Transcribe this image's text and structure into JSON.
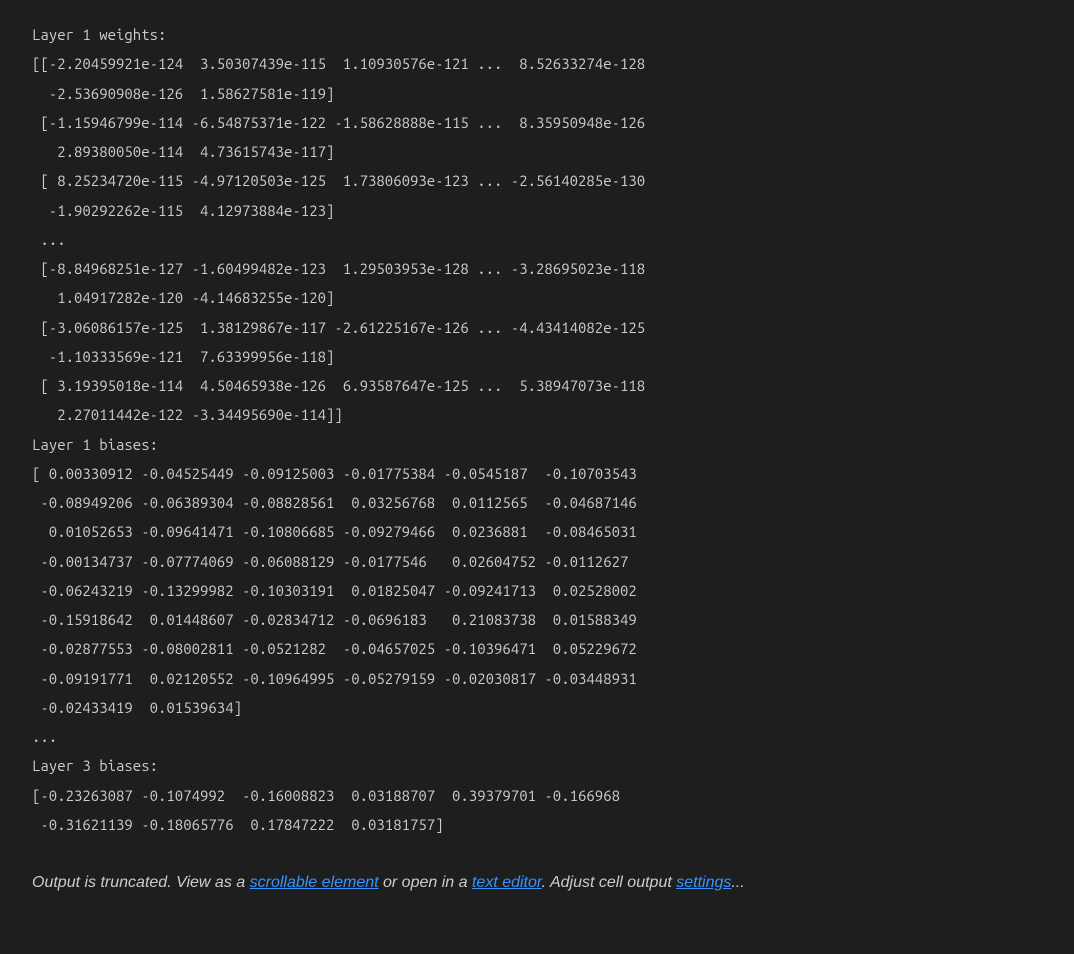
{
  "output": {
    "layer1_weights_header": "Layer 1 weights:",
    "layer1_weights_body": "[[-2.20459921e-124  3.50307439e-115  1.10930576e-121 ...  8.52633274e-128\n  -2.53690908e-126  1.58627581e-119]\n [-1.15946799e-114 -6.54875371e-122 -1.58628888e-115 ...  8.35950948e-126\n   2.89380050e-114  4.73615743e-117]\n [ 8.25234720e-115 -4.97120503e-125  1.73806093e-123 ... -2.56140285e-130\n  -1.90292262e-115  4.12973884e-123]\n ...\n [-8.84968251e-127 -1.60499482e-123  1.29503953e-128 ... -3.28695023e-118\n   1.04917282e-120 -4.14683255e-120]\n [-3.06086157e-125  1.38129867e-117 -2.61225167e-126 ... -4.43414082e-125\n  -1.10333569e-121  7.63399956e-118]\n [ 3.19395018e-114  4.50465938e-126  6.93587647e-125 ...  5.38947073e-118\n   2.27011442e-122 -3.34495690e-114]]",
    "blank1": "",
    "layer1_biases_header": "Layer 1 biases:",
    "layer1_biases_body": "[ 0.00330912 -0.04525449 -0.09125003 -0.01775384 -0.0545187  -0.10703543\n -0.08949206 -0.06389304 -0.08828561  0.03256768  0.0112565  -0.04687146\n  0.01052653 -0.09641471 -0.10806685 -0.09279466  0.0236881  -0.08465031\n -0.00134737 -0.07774069 -0.06088129 -0.0177546   0.02604752 -0.0112627\n -0.06243219 -0.13299982 -0.10303191  0.01825047 -0.09241713  0.02528002\n -0.15918642  0.01448607 -0.02834712 -0.0696183   0.21083738  0.01588349\n -0.02877553 -0.08002811 -0.0521282  -0.04657025 -0.10396471  0.05229672\n -0.09191771  0.02120552 -0.10964995 -0.05279159 -0.02030817 -0.03448931\n -0.02433419  0.01539634]",
    "ellipsis": "...",
    "layer3_biases_header": "Layer 3 biases:",
    "layer3_biases_body": "[-0.23263087 -0.1074992  -0.16008823  0.03188707  0.39379701 -0.166968\n -0.31621139 -0.18065776  0.17847222  0.03181757]"
  },
  "truncation": {
    "prefix1": "Output is truncated. View as a ",
    "link1": "scrollable element",
    "middle1": " or open in a ",
    "link2": "text editor",
    "middle2": ". Adjust cell output ",
    "link3": "settings",
    "suffix": "..."
  }
}
